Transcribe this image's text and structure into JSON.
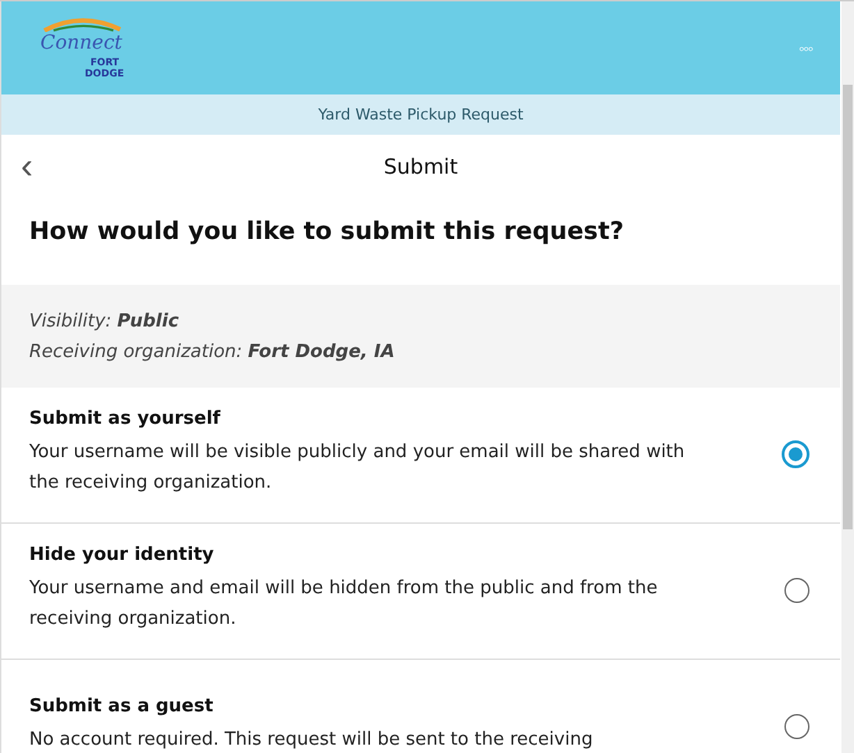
{
  "header": {
    "logo": {
      "script": "Connect",
      "line1": "FORT",
      "line2": "DODGE"
    },
    "menu": "◦◦◦"
  },
  "subheader": {
    "title": "Yard Waste Pickup Request"
  },
  "nav": {
    "back": "‹",
    "title": "Submit"
  },
  "question": "How would you like to submit this request?",
  "info": [
    "Visibility: **Public**",
    "Receiving organization: **Fort Dodge, IA**"
  ],
  "options": [
    {
      "title": "Submit as yourself",
      "description": "Your username will be visible publicly and your email will be shared with the receiving organization.",
      "selected": true
    },
    {
      "title": "Hide your identity",
      "description": "Your username and email will be hidden from the public and from the receiving organization.",
      "selected": false
    },
    {
      "title": "Submit as a guest",
      "description": "No account required. This request will be sent to the receiving",
      "selected": false
    }
  ]
}
